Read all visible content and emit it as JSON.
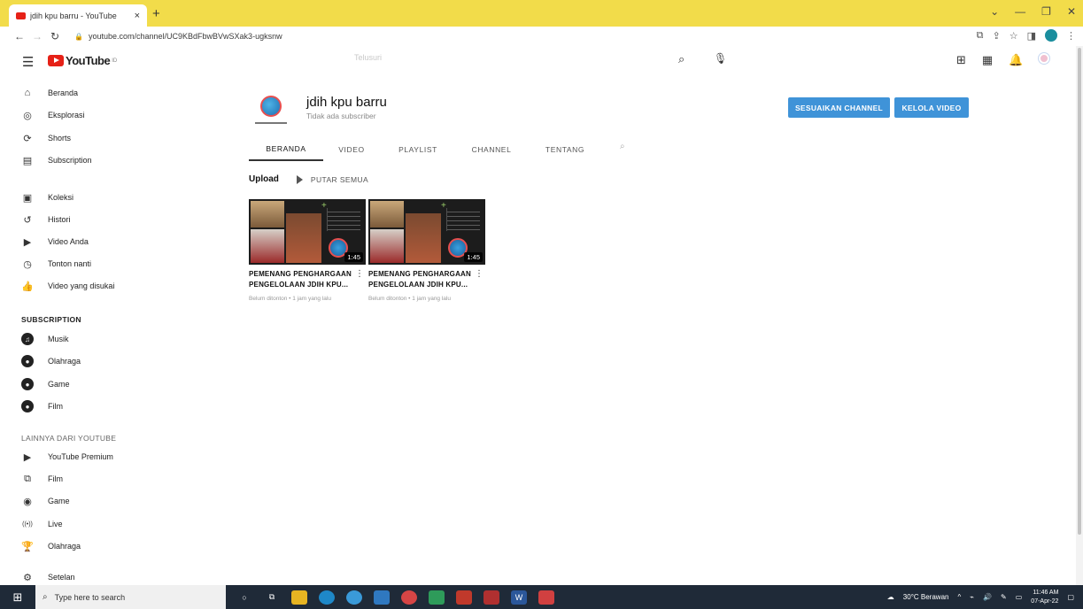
{
  "browser": {
    "tab_title": "jdih kpu barru - YouTube",
    "tab_close": "×",
    "new_tab": "+",
    "url": "youtube.com/channel/UC9KBdFbwBVwSXak3-ugksnw",
    "window_controls": [
      "⌄",
      "—",
      "❐",
      "✕"
    ]
  },
  "header": {
    "logo_text": "YouTube",
    "logo_suffix": "ID",
    "search_placeholder": "Telusuri"
  },
  "sidebar": {
    "main": [
      {
        "label": "Beranda",
        "icon": "home-icon",
        "glyph": "⌂"
      },
      {
        "label": "Eksplorasi",
        "icon": "compass-icon",
        "glyph": "◎"
      },
      {
        "label": "Shorts",
        "icon": "shorts-icon",
        "glyph": "⟳"
      },
      {
        "label": "Subscription",
        "icon": "subscriptions-icon",
        "glyph": "▤"
      }
    ],
    "library": [
      {
        "label": "Koleksi",
        "icon": "library-icon",
        "glyph": "▣"
      },
      {
        "label": "Histori",
        "icon": "history-icon",
        "glyph": "↺"
      },
      {
        "label": "Video Anda",
        "icon": "your-videos-icon",
        "glyph": "▶"
      },
      {
        "label": "Tonton nanti",
        "icon": "watch-later-icon",
        "glyph": "◷"
      },
      {
        "label": "Video yang disukai",
        "icon": "like-icon",
        "glyph": "👍"
      }
    ],
    "subscription_heading": "SUBSCRIPTION",
    "subscriptions": [
      {
        "label": "Musik",
        "icon": "music-channel-icon",
        "glyph": "♫"
      },
      {
        "label": "Olahraga",
        "icon": "sports-channel-icon",
        "glyph": "●"
      },
      {
        "label": "Game",
        "icon": "gaming-channel-icon",
        "glyph": "●"
      },
      {
        "label": "Film",
        "icon": "film-channel-icon",
        "glyph": "●"
      }
    ],
    "more_heading": "LAINNYA DARI YOUTUBE",
    "more": [
      {
        "label": "YouTube Premium",
        "icon": "premium-icon",
        "glyph": "▶"
      },
      {
        "label": "Film",
        "icon": "film-icon",
        "glyph": "⧉"
      },
      {
        "label": "Game",
        "icon": "game-icon",
        "glyph": "◉"
      },
      {
        "label": "Live",
        "icon": "live-icon",
        "glyph": "((•))"
      },
      {
        "label": "Olahraga",
        "icon": "trophy-icon",
        "glyph": "🏆"
      }
    ],
    "settings": {
      "label": "Setelan",
      "icon": "settings-icon",
      "glyph": "⚙"
    }
  },
  "channel": {
    "name": "jdih kpu barru",
    "subscribers": "Tidak ada subscriber",
    "customize_button": "SESUAIKAN CHANNEL",
    "manage_button": "KELOLA VIDEO",
    "tabs": [
      "BERANDA",
      "VIDEO",
      "PLAYLIST",
      "CHANNEL",
      "TENTANG"
    ],
    "active_tab": "BERANDA",
    "section_title": "Upload",
    "play_all": "PUTAR SEMUA"
  },
  "videos": [
    {
      "title": "PEMENANG PENGHARGAAN PENGELOLAAN JDIH KPU...",
      "duration": "1:45",
      "meta": "Belum ditonton • 1 jam yang lalu"
    },
    {
      "title": "PEMENANG PENGHARGAAN PENGELOLAAN JDIH KPU...",
      "duration": "1:45",
      "meta": "Belum ditonton • 1 jam yang lalu"
    }
  ],
  "taskbar": {
    "search_placeholder": "Type here to search",
    "weather": "30°C  Berawan",
    "time": "11:46 AM",
    "date": "07-Apr-22"
  },
  "colors": {
    "tab_bar": "#f2dc4a",
    "accent_button": "#3f93d8",
    "youtube_red": "#e62117",
    "taskbar": "#1f2a38"
  }
}
